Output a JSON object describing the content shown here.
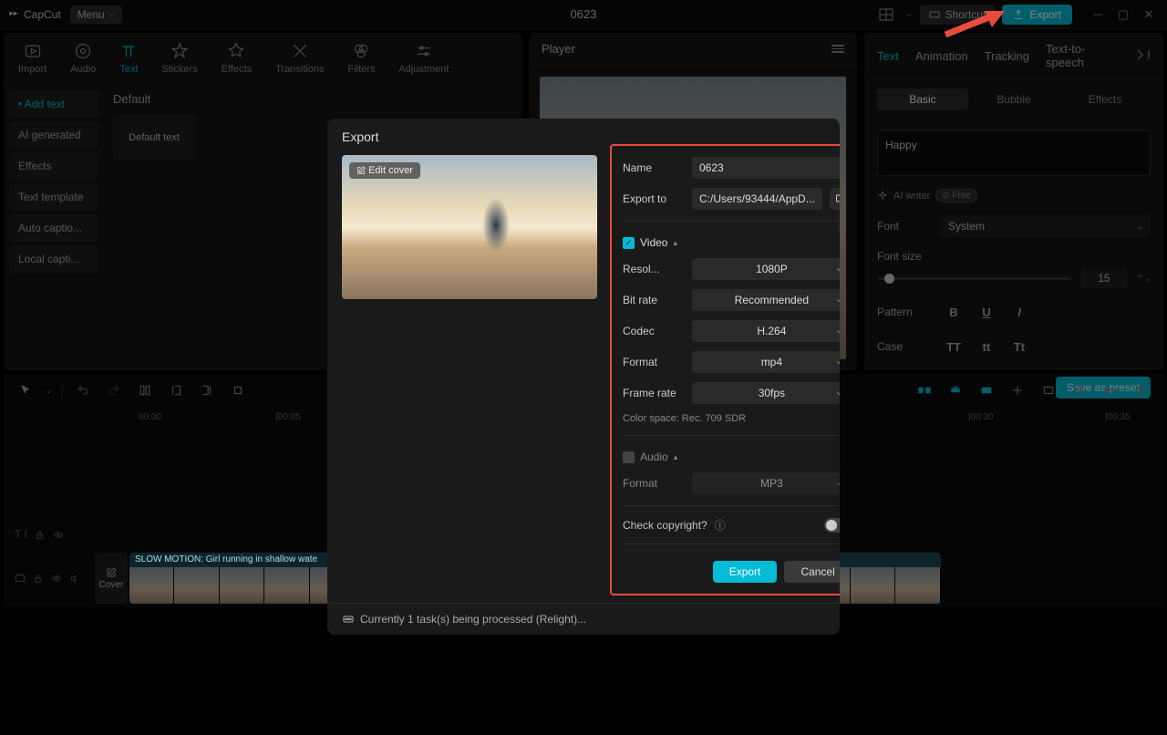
{
  "app": {
    "name": "CapCut",
    "menu": "Menu",
    "title": "0623",
    "shortcut": "Shortcut",
    "export": "Export"
  },
  "topTabs": [
    "Import",
    "Audio",
    "Text",
    "Stickers",
    "Effects",
    "Transitions",
    "Filters",
    "Adjustment"
  ],
  "sidebar": [
    "Add text",
    "AI generated",
    "Effects",
    "Text template",
    "Auto captio...",
    "Local capti..."
  ],
  "leftMain": {
    "category": "Default",
    "card1": "Default text"
  },
  "player": {
    "title": "Player"
  },
  "rightTabs": [
    "Text",
    "Animation",
    "Tracking",
    "Text-to-speech"
  ],
  "subTabs": [
    "Basic",
    "Bubble",
    "Effects"
  ],
  "textProps": {
    "content": "Happy",
    "aiWriter": "AI writer",
    "aiFree": "Free",
    "fontLabel": "Font",
    "fontValue": "System",
    "sizeLabel": "Font size",
    "sizeValue": "15",
    "patternLabel": "Pattern",
    "caseLabel": "Case",
    "caseTT": "TT",
    "casett": "tt",
    "caseTt": "Tt",
    "preset": "Save as preset"
  },
  "ruler": [
    "00:00",
    "|00:05",
    "|00:30",
    "|00:35"
  ],
  "clip": {
    "label": "SLOW MOTION: Girl running in shallow wate",
    "cover": "Cover"
  },
  "modal": {
    "title": "Export",
    "editCover": "Edit cover",
    "nameLabel": "Name",
    "nameValue": "0623",
    "exportToLabel": "Export to",
    "exportToValue": "C:/Users/93444/AppD...",
    "videoSection": "Video",
    "resLabel": "Resol...",
    "resValue": "1080P",
    "bitLabel": "Bit rate",
    "bitValue": "Recommended",
    "codecLabel": "Codec",
    "codecValue": "H.264",
    "formatLabel": "Format",
    "formatValue": "mp4",
    "fpsLabel": "Frame rate",
    "fpsValue": "30fps",
    "colorSpace": "Color space: Rec. 709 SDR",
    "audioSection": "Audio",
    "audioFormatLabel": "Format",
    "audioFormatValue": "MP3",
    "copyrightLabel": "Check copyright?",
    "exportBtn": "Export",
    "cancelBtn": "Cancel",
    "tasks": "Currently 1 task(s) being processed (Relight)..."
  }
}
